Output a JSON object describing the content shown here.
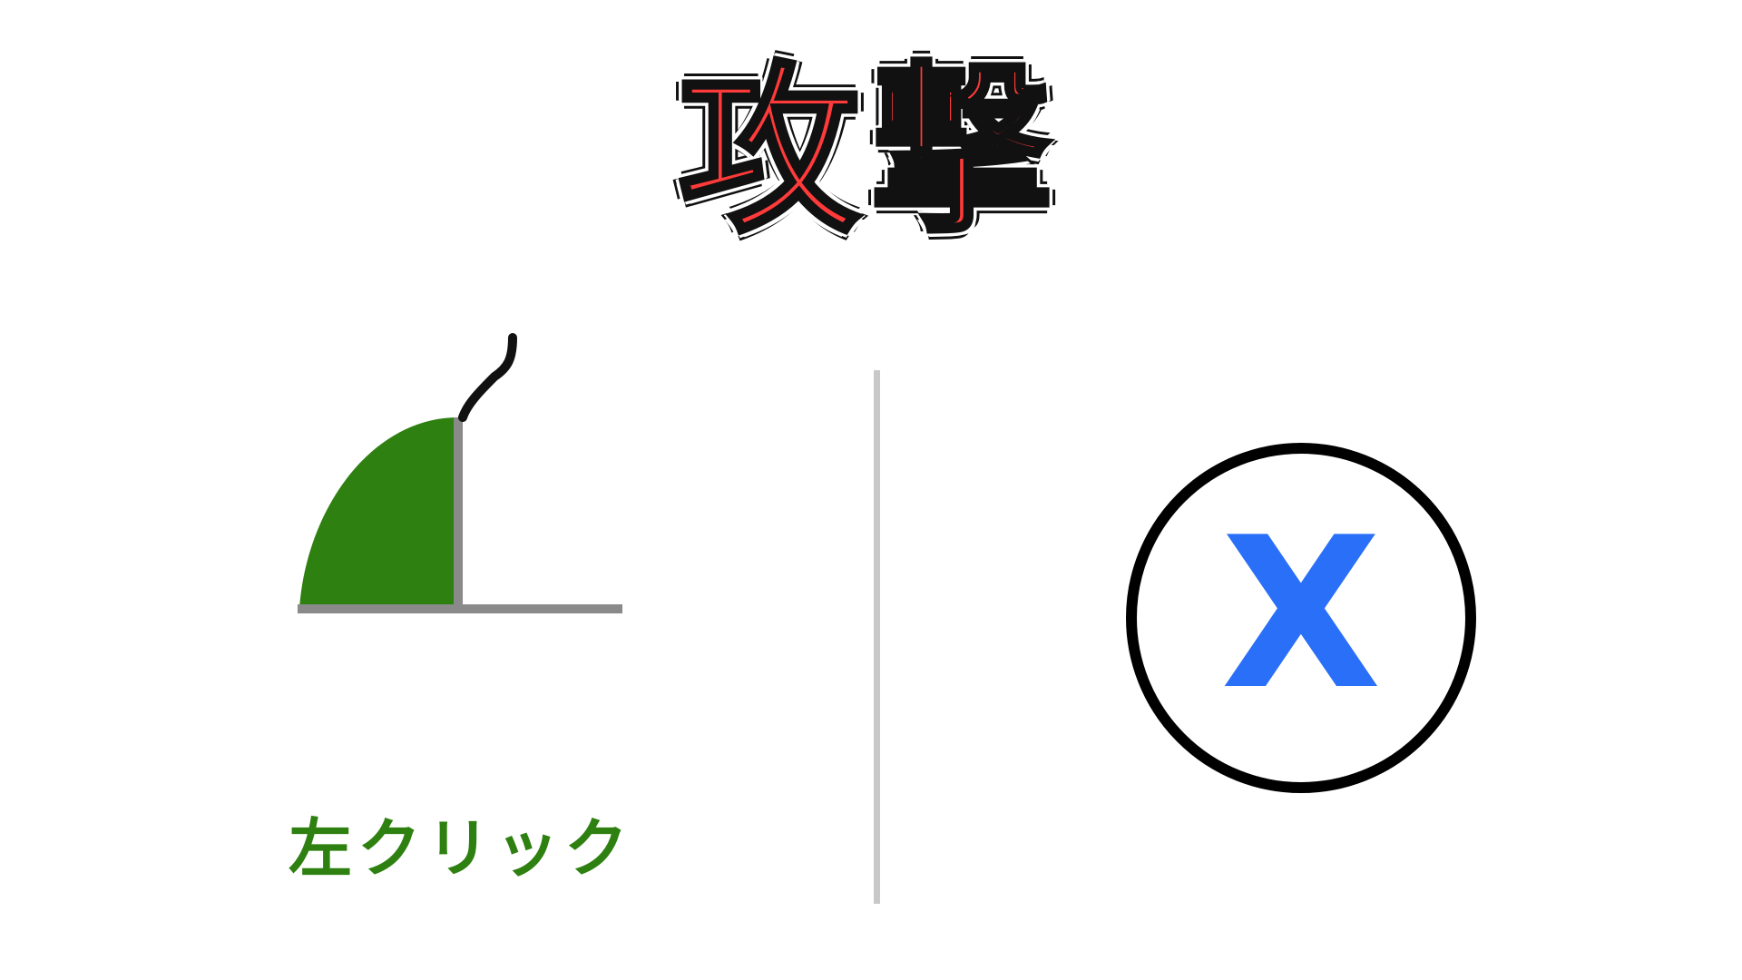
{
  "title": "攻撃",
  "left_action": {
    "icon": "mouse-left-click-icon",
    "caption": "左クリック"
  },
  "right_action": {
    "key_icon": "x-key-button-icon",
    "key_label": "X"
  },
  "colors": {
    "title_fill": "#ff3a3a",
    "title_outline": "#111111",
    "mouse_button_fill": "#2e8010",
    "mouse_body_line": "#8a8a8a",
    "divider": "#c8c8c8",
    "key_letter": "#2a6ff7",
    "key_ring": "#000000",
    "background": "#ffffff"
  }
}
